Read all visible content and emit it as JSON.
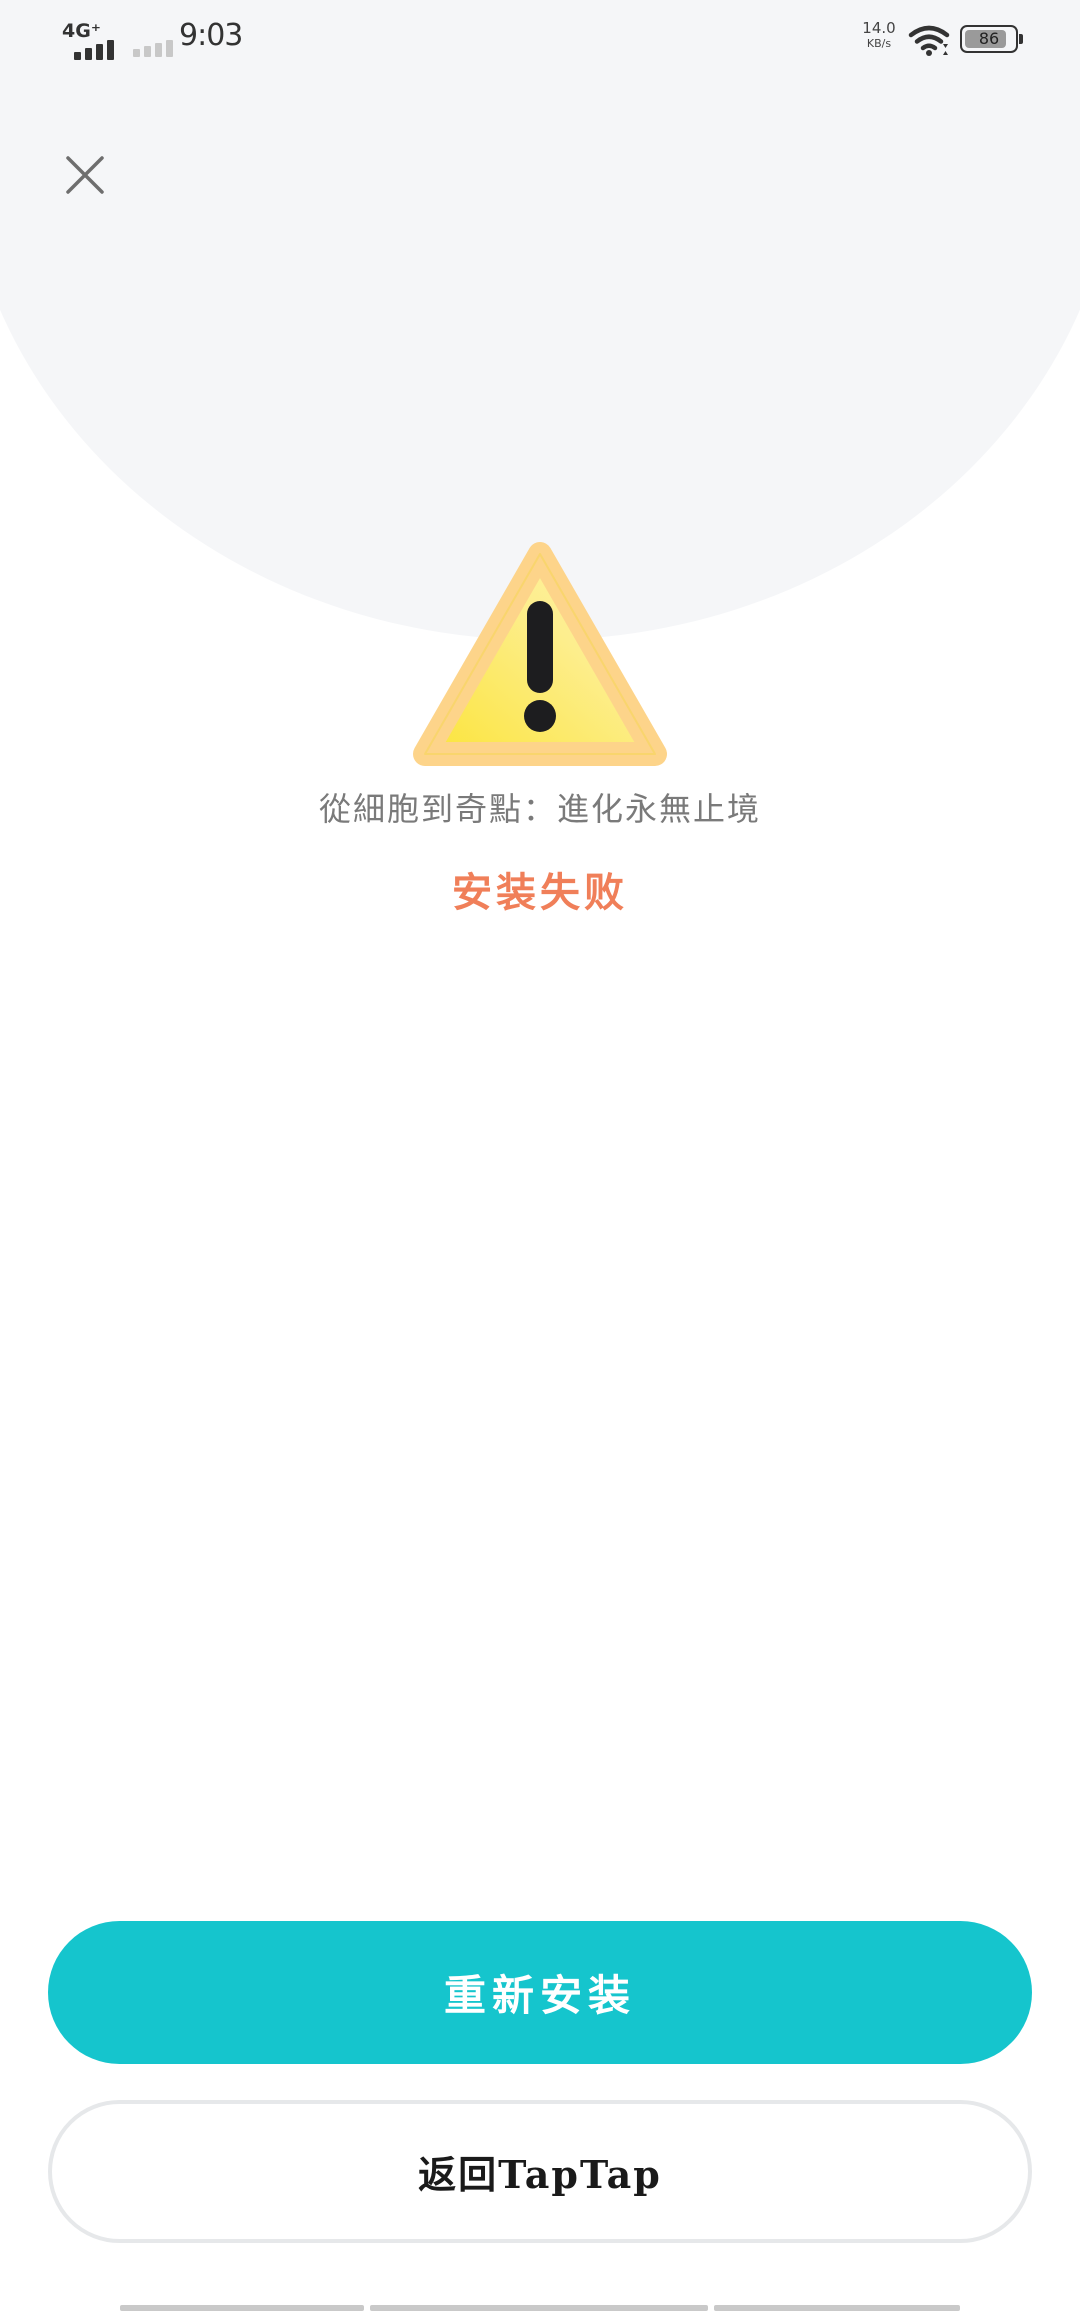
{
  "status_bar": {
    "network": "4G⁺",
    "time": "9:03",
    "net_speed_value": "14.0",
    "net_speed_unit": "KB/s",
    "battery": "86",
    "battery_level": 0.86
  },
  "header": {
    "close_icon": "close-icon"
  },
  "install": {
    "app_name": "從細胞到奇點：進化永無止境",
    "status": "安装失败",
    "status_color": "#f07f59",
    "warning_icon": "warning-triangle-icon"
  },
  "actions": {
    "reinstall_label": "重新安装",
    "reinstall_color": "#15c5cd",
    "back_label": "返回TapTap"
  }
}
